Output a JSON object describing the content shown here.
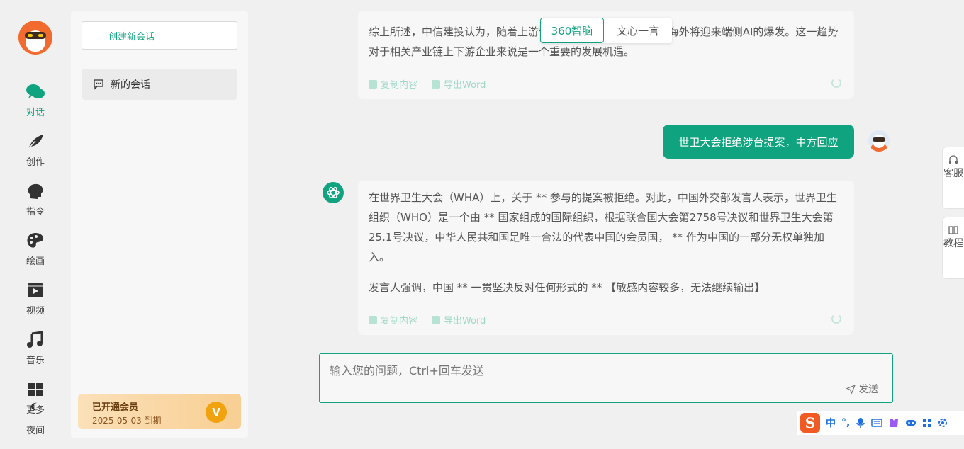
{
  "nav": {
    "items": [
      {
        "label": "对话",
        "icon": "chat-icon",
        "active": true
      },
      {
        "label": "创作",
        "icon": "feather-icon"
      },
      {
        "label": "指令",
        "icon": "head-icon"
      },
      {
        "label": "绘画",
        "icon": "palette-icon"
      },
      {
        "label": "视频",
        "icon": "video-icon"
      },
      {
        "label": "音乐",
        "icon": "music-icon"
      },
      {
        "label": "更多",
        "icon": "grid-icon"
      }
    ],
    "night_label": "夜间"
  },
  "panel": {
    "new_chat_label": "创建新会话",
    "sessions": [
      {
        "title": "新的会话"
      }
    ],
    "vip": {
      "title": "已开通会员",
      "expiry": "2025-05-03 到期",
      "badge": "V"
    }
  },
  "model_switch": {
    "options": [
      "360智脑",
      "文心一言"
    ],
    "selected": "360智脑"
  },
  "messages": {
    "prev_bot": {
      "text": "综上所述，中信建投认为，随着上游供应链的成熟，2023年6月海外将迎来端侧AI的爆发。这一趋势对于相关产业链上下游企业来说是一个重要的发展机遇。"
    },
    "user": {
      "text": "世卫大会拒绝涉台提案，中方回应"
    },
    "bot": {
      "para1": "在世界卫生大会（WHA）上，关于 ** 参与的提案被拒绝。对此，中国外交部发言人表示，世界卫生组织（WHO）是一个由 ** 国家组成的国际组织，根据联合国大会第2758号决议和世界卫生大会第25.1号决议，中华人民共和国是唯一合法的代表中国的会员国， ** 作为中国的一部分无权单独加入。",
      "para2": "发言人强调，中国 ** 一贯坚决反对任何形式的 ** 【敏感内容较多，无法继续输出】"
    },
    "actions": {
      "copy": "复制内容",
      "export": "导出Word"
    }
  },
  "input": {
    "placeholder": "输入您的问题，Ctrl+回车发送",
    "send": "发送"
  },
  "side_tabs": [
    {
      "label": "客服"
    },
    {
      "label": "教程"
    }
  ],
  "ime": {
    "logo": "S",
    "mode": "中",
    "punct": "°,"
  },
  "colors": {
    "accent": "#10a37f",
    "vip": "#f8cf93",
    "logo": "#f26a2e"
  }
}
